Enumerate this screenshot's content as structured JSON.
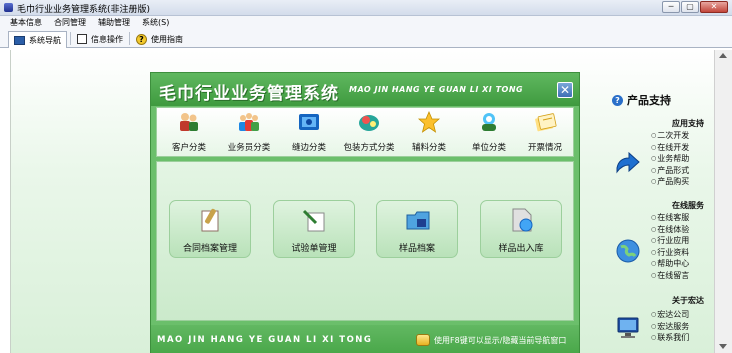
{
  "window": {
    "title": "毛巾行业业务管理系统(非注册版)",
    "min_label": "─",
    "max_label": "▢",
    "close_label": "✕"
  },
  "menu": [
    "基本信息",
    "合同管理",
    "辅助管理",
    "系统(S)"
  ],
  "tabs": [
    {
      "label": "系统导航",
      "icon": "monitor-icon",
      "active": true
    },
    {
      "label": "信息操作",
      "icon": "checkbox-icon",
      "active": false
    },
    {
      "label": "使用指南",
      "icon": "help-icon",
      "active": false
    }
  ],
  "panel": {
    "title": "毛巾行业业务管理系统",
    "pinyin": "MAO JIN HANG YE GUAN LI XI TONG",
    "close_label": "✕",
    "toolbar": [
      {
        "label": "客户分类",
        "icon": "customers-icon"
      },
      {
        "label": "业务员分类",
        "icon": "salesmen-icon"
      },
      {
        "label": "缝边分类",
        "icon": "hemming-icon"
      },
      {
        "label": "包装方式分类",
        "icon": "packaging-icon"
      },
      {
        "label": "辅料分类",
        "icon": "star-icon"
      },
      {
        "label": "单位分类",
        "icon": "unit-icon"
      },
      {
        "label": "开票情况",
        "icon": "invoice-icon"
      }
    ],
    "buttons": [
      {
        "label": "合同档案管理",
        "icon": "contract-icon"
      },
      {
        "label": "试验单管理",
        "icon": "test-sheet-icon"
      },
      {
        "label": "样品档案",
        "icon": "sample-folder-icon"
      },
      {
        "label": "样品出入库",
        "icon": "sample-stock-icon"
      }
    ],
    "footer_pinyin": "MAO JIN HANG YE GUAN LI XI TONG",
    "footer_tip": "使用F8键可以显示/隐藏当前导航窗口"
  },
  "sidebar": {
    "title": "产品支持",
    "groups": [
      {
        "title": "应用支持",
        "icon": "arrow-icon",
        "items": [
          "二次开发",
          "在线开发",
          "业务帮助",
          "产品形式",
          "产品购买"
        ]
      },
      {
        "title": "在线服务",
        "icon": "globe-icon",
        "items": [
          "在线客服",
          "在线体验",
          "行业应用",
          "行业资料",
          "帮助中心",
          "在线留言"
        ]
      },
      {
        "title": "关于宏达",
        "icon": "computer-icon",
        "items": [
          "宏达公司",
          "宏达服务",
          "联系我们"
        ]
      }
    ]
  },
  "colors": {
    "panel_green": "#6bbf6b",
    "header_green": "#3f9a3f",
    "close_blue": "#3f6fb5"
  }
}
